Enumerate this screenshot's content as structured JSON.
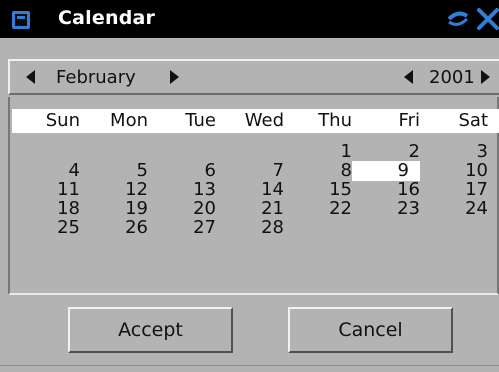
{
  "window": {
    "title": "Calendar",
    "app_icon": "calendar-window-icon",
    "close_icon": "close-icon"
  },
  "navigation": {
    "month": "February",
    "year": "2001",
    "prev_icon": "arrow-left-icon",
    "next_icon": "arrow-right-icon"
  },
  "calendar": {
    "weekdays": [
      "Sun",
      "Mon",
      "Tue",
      "Wed",
      "Thu",
      "Fri",
      "Sat"
    ],
    "weeks": [
      [
        "",
        "",
        "",
        "",
        "1",
        "2",
        "3"
      ],
      [
        "4",
        "5",
        "6",
        "7",
        "8",
        "9",
        "10"
      ],
      [
        "11",
        "12",
        "13",
        "14",
        "15",
        "16",
        "17"
      ],
      [
        "18",
        "19",
        "20",
        "21",
        "22",
        "23",
        "24"
      ],
      [
        "25",
        "26",
        "27",
        "28",
        "",
        "",
        ""
      ]
    ],
    "selected_day": "9"
  },
  "buttons": {
    "accept": "Accept",
    "cancel": "Cancel"
  },
  "colors": {
    "titlebar": "#000000",
    "background": "#b3b3b3",
    "highlight": "#ffffff",
    "icon_blue": "#2f7fd8"
  }
}
